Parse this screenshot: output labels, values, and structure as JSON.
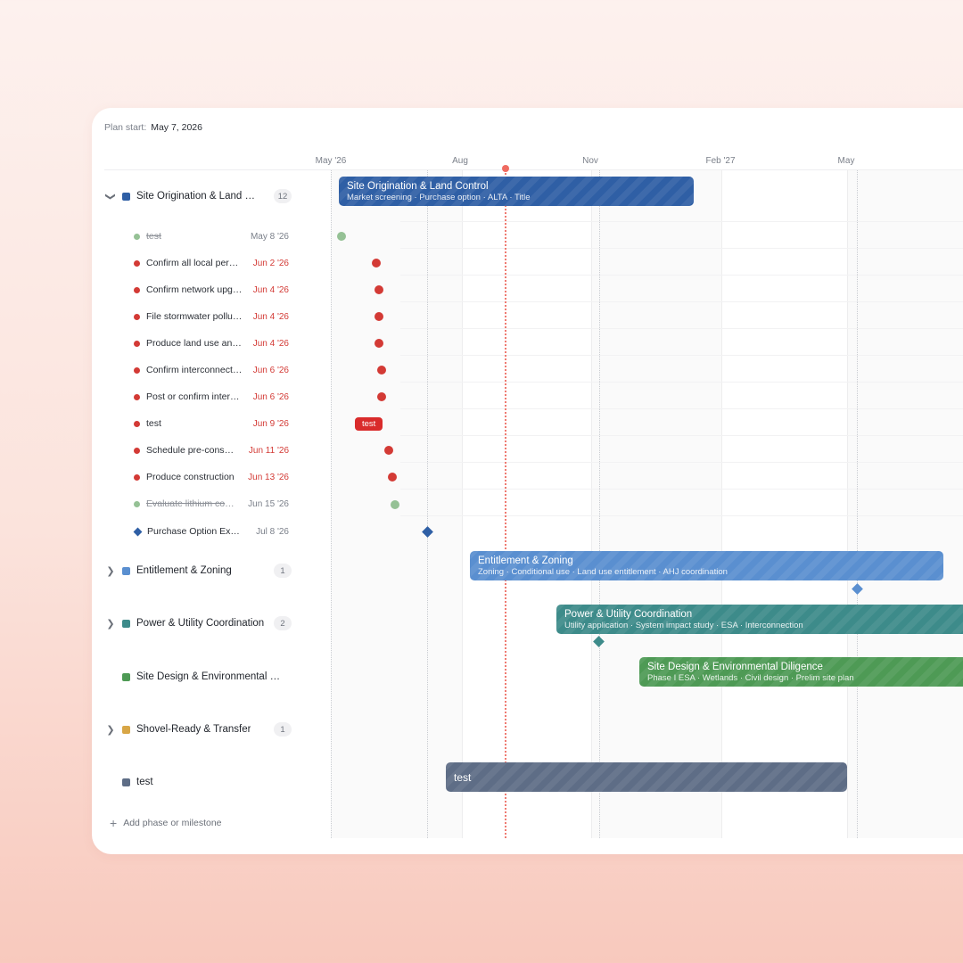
{
  "header": {
    "plan_start_label": "Plan start:",
    "plan_start_value": "May 7, 2026"
  },
  "timeline": {
    "months": [
      "May '26",
      "Aug",
      "Nov",
      "Feb '27",
      "May"
    ]
  },
  "colors": {
    "site_origination": "#2f5fa5",
    "entitlement": "#5a8fd0",
    "power": "#3d8b8a",
    "site_design": "#4e9a55",
    "shovel_ready": "#d8a646",
    "test_phase": "#5e6d86",
    "late": "#d33a35",
    "done": "#95c195",
    "today": "#ef6b61"
  },
  "phases": [
    {
      "key": "site_origination",
      "name": "Site Origination & Land Control",
      "count": "12",
      "expanded": true,
      "bar_title": "Site Origination & Land Control",
      "bar_subtitle": "Market screening · Purchase option · ALTA · Title"
    },
    {
      "key": "entitlement",
      "name": "Entitlement & Zoning",
      "count": "1",
      "expanded": false,
      "bar_title": "Entitlement & Zoning",
      "bar_subtitle": "Zoning · Conditional use · Land use entitlement · AHJ coordination"
    },
    {
      "key": "power",
      "name": "Power & Utility Coordination",
      "count": "2",
      "expanded": false,
      "bar_title": "Power & Utility Coordination",
      "bar_subtitle": "Utility application · System impact study · ESA · Interconnection"
    },
    {
      "key": "site_design",
      "name": "Site Design & Environmental Diligence",
      "count": "",
      "expanded": false,
      "bar_title": "Site Design & Environmental Diligence",
      "bar_subtitle": "Phase I ESA · Wetlands · Civil design · Prelim site plan"
    },
    {
      "key": "shovel_ready",
      "name": "Shovel-Ready & Transfer",
      "count": "1",
      "expanded": false,
      "bar_title": "",
      "bar_subtitle": ""
    },
    {
      "key": "test_phase",
      "name": "test",
      "count": "",
      "expanded": false,
      "bar_title": "test",
      "bar_subtitle": ""
    }
  ],
  "tasks": [
    {
      "name": "test",
      "date": "May 8 '26",
      "status": "done"
    },
    {
      "name": "Confirm all local permits",
      "date": "Jun 2 '26",
      "status": "late"
    },
    {
      "name": "Confirm network upgrades",
      "date": "Jun 4 '26",
      "status": "late"
    },
    {
      "name": "File stormwater pollution plan",
      "date": "Jun 4 '26",
      "status": "late"
    },
    {
      "name": "Produce land use analysis",
      "date": "Jun 4 '26",
      "status": "late"
    },
    {
      "name": "Confirm interconnection",
      "date": "Jun 6 '26",
      "status": "late"
    },
    {
      "name": "Post or confirm interconnection",
      "date": "Jun 6 '26",
      "status": "late"
    },
    {
      "name": "test",
      "date": "Jun 9 '26",
      "status": "late",
      "pill": "test"
    },
    {
      "name": "Schedule pre-construction",
      "date": "Jun 11 '26",
      "status": "late"
    },
    {
      "name": "Produce construction",
      "date": "Jun 13 '26",
      "status": "late"
    },
    {
      "name": "Evaluate lithium compliance",
      "date": "Jun 15 '26",
      "status": "done"
    },
    {
      "name": "Purchase Option Execution",
      "date": "Jul 8 '26",
      "status": "milestone"
    }
  ],
  "add_row": {
    "icon": "plus-icon",
    "label": "Add phase or milestone"
  }
}
